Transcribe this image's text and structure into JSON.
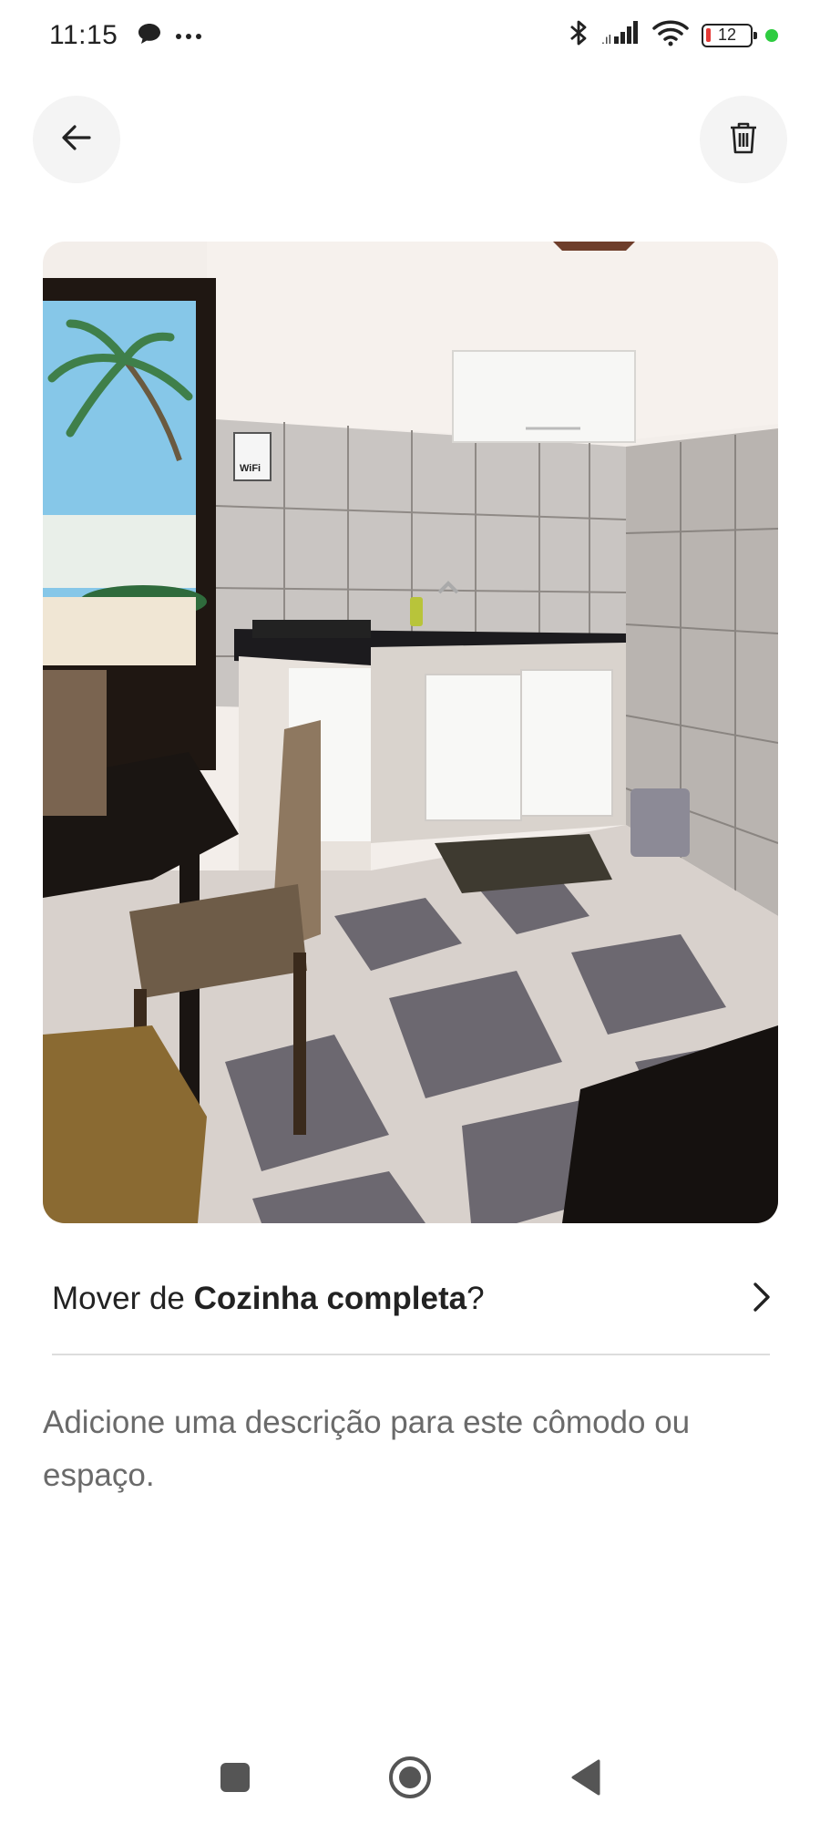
{
  "status_bar": {
    "time": "11:15",
    "battery_level": "12",
    "icons": [
      "chat-bubble-icon",
      "more-dots-icon",
      "bluetooth-icon",
      "signal-icon",
      "wifi-icon",
      "battery-icon",
      "active-dot-icon"
    ]
  },
  "header": {
    "back_icon": "arrow-left-icon",
    "delete_icon": "trash-icon"
  },
  "photo": {
    "subject": "kitchen-photo",
    "wifi_sign": "WiFi"
  },
  "move_row": {
    "prefix": "Mover de ",
    "room_name": "Cozinha completa",
    "suffix": "?",
    "chevron_icon": "chevron-right-icon"
  },
  "description": {
    "placeholder": "Adicione uma descrição para este cômodo ou espaço."
  },
  "nav_bar": {
    "icons": [
      "recents-square-icon",
      "home-circle-icon",
      "back-triangle-icon"
    ]
  },
  "colors": {
    "accent_green": "#2ecc40",
    "battery_low": "#e53935",
    "placeholder_text": "#6a6a6a",
    "divider": "#dddddd"
  }
}
